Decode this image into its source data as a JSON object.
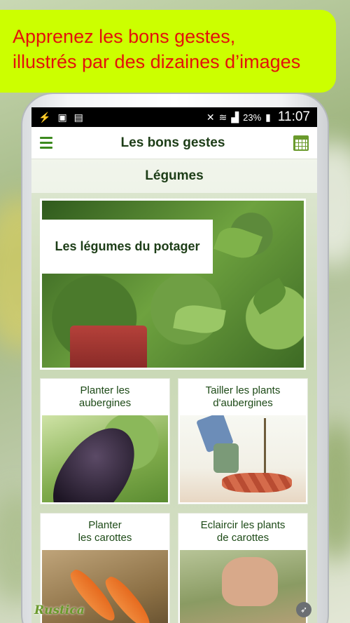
{
  "promo": {
    "line1": "Apprenez les bons gestes,",
    "line2": "illustrés par des dizaines d’images"
  },
  "status_bar": {
    "battery": "23%",
    "time": "11:07"
  },
  "app_bar": {
    "title": "Les bons gestes",
    "menu_icon": "hamburger-menu-icon",
    "calendar_icon": "calendar-icon"
  },
  "section": {
    "title": "Légumes"
  },
  "hero": {
    "label": "Les légumes du potager"
  },
  "cards": [
    {
      "title_line1": "Planter les",
      "title_line2": "aubergines"
    },
    {
      "title_line1": "Tailler les plants",
      "title_line2": "d'aubergines"
    },
    {
      "title_line1": "Planter",
      "title_line2": "les carottes"
    },
    {
      "title_line1": "Eclaircir les plants",
      "title_line2": "de carottes"
    }
  ],
  "footer": {
    "logo": "Rustica"
  },
  "colors": {
    "promo_bg": "#ccff00",
    "promo_text": "#e3120b",
    "accent_green": "#3c8a1e",
    "title_dark_green": "#1d3d17"
  }
}
